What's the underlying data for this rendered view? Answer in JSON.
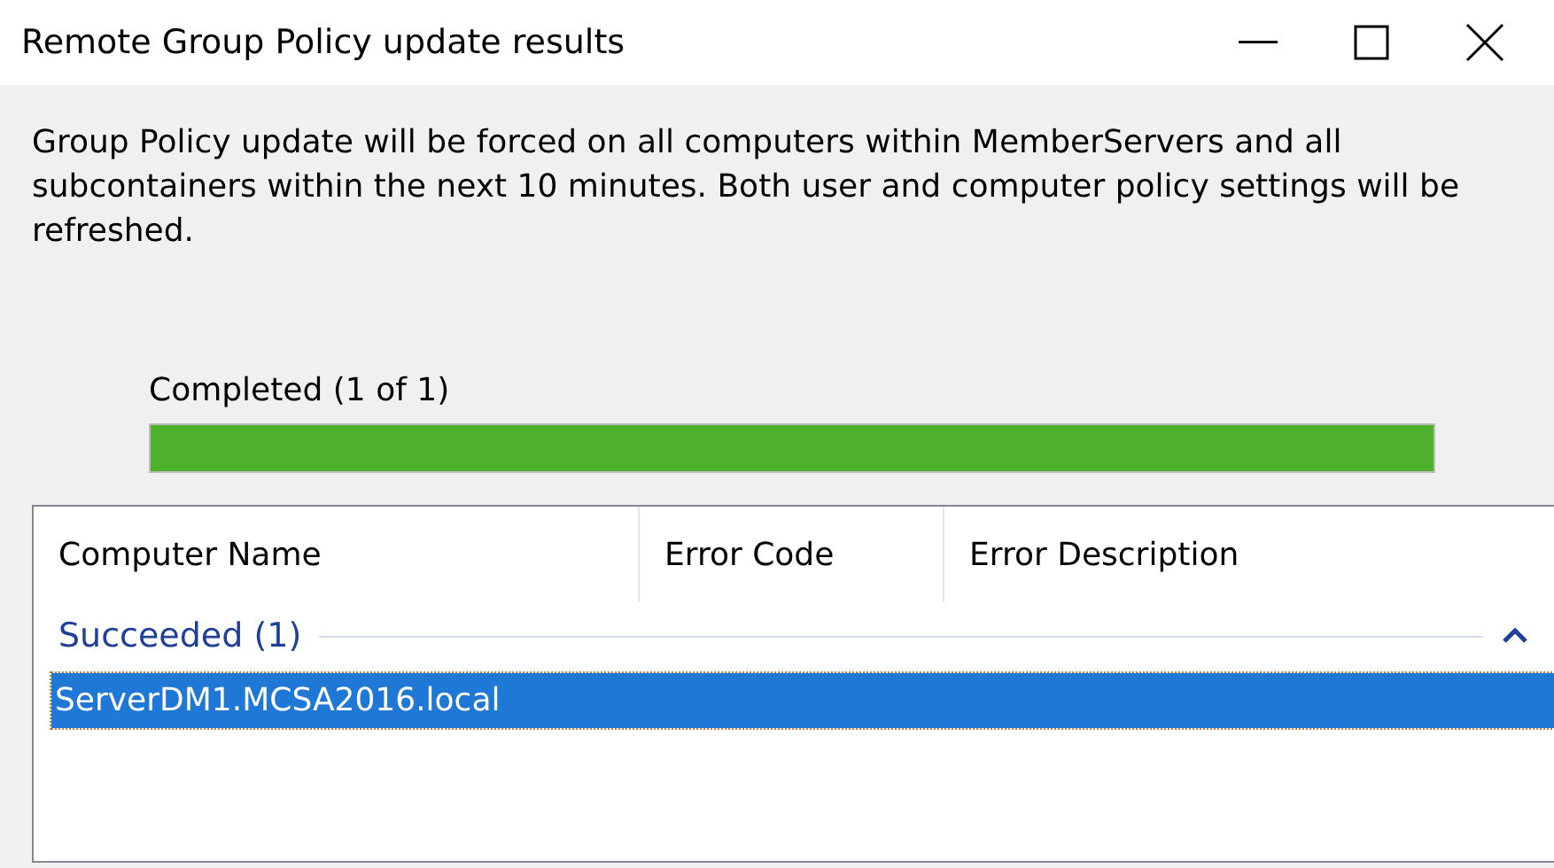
{
  "window": {
    "title": "Remote Group Policy update results"
  },
  "description": "Group Policy update will be forced on all computers within MemberServers and all subcontainers within the next 10 minutes. Both user and computer policy settings will be refreshed.",
  "progress": {
    "label": "Completed (1 of 1)",
    "level": 1
  },
  "table": {
    "columns": [
      "Computer Name",
      "Error Code",
      "Error Description"
    ],
    "groups": [
      {
        "label": "Succeeded (1)",
        "expanded": true,
        "rows": [
          {
            "cells": [
              "ServerDM1.MCSA2016.local"
            ],
            "selected": true
          }
        ]
      }
    ]
  }
}
